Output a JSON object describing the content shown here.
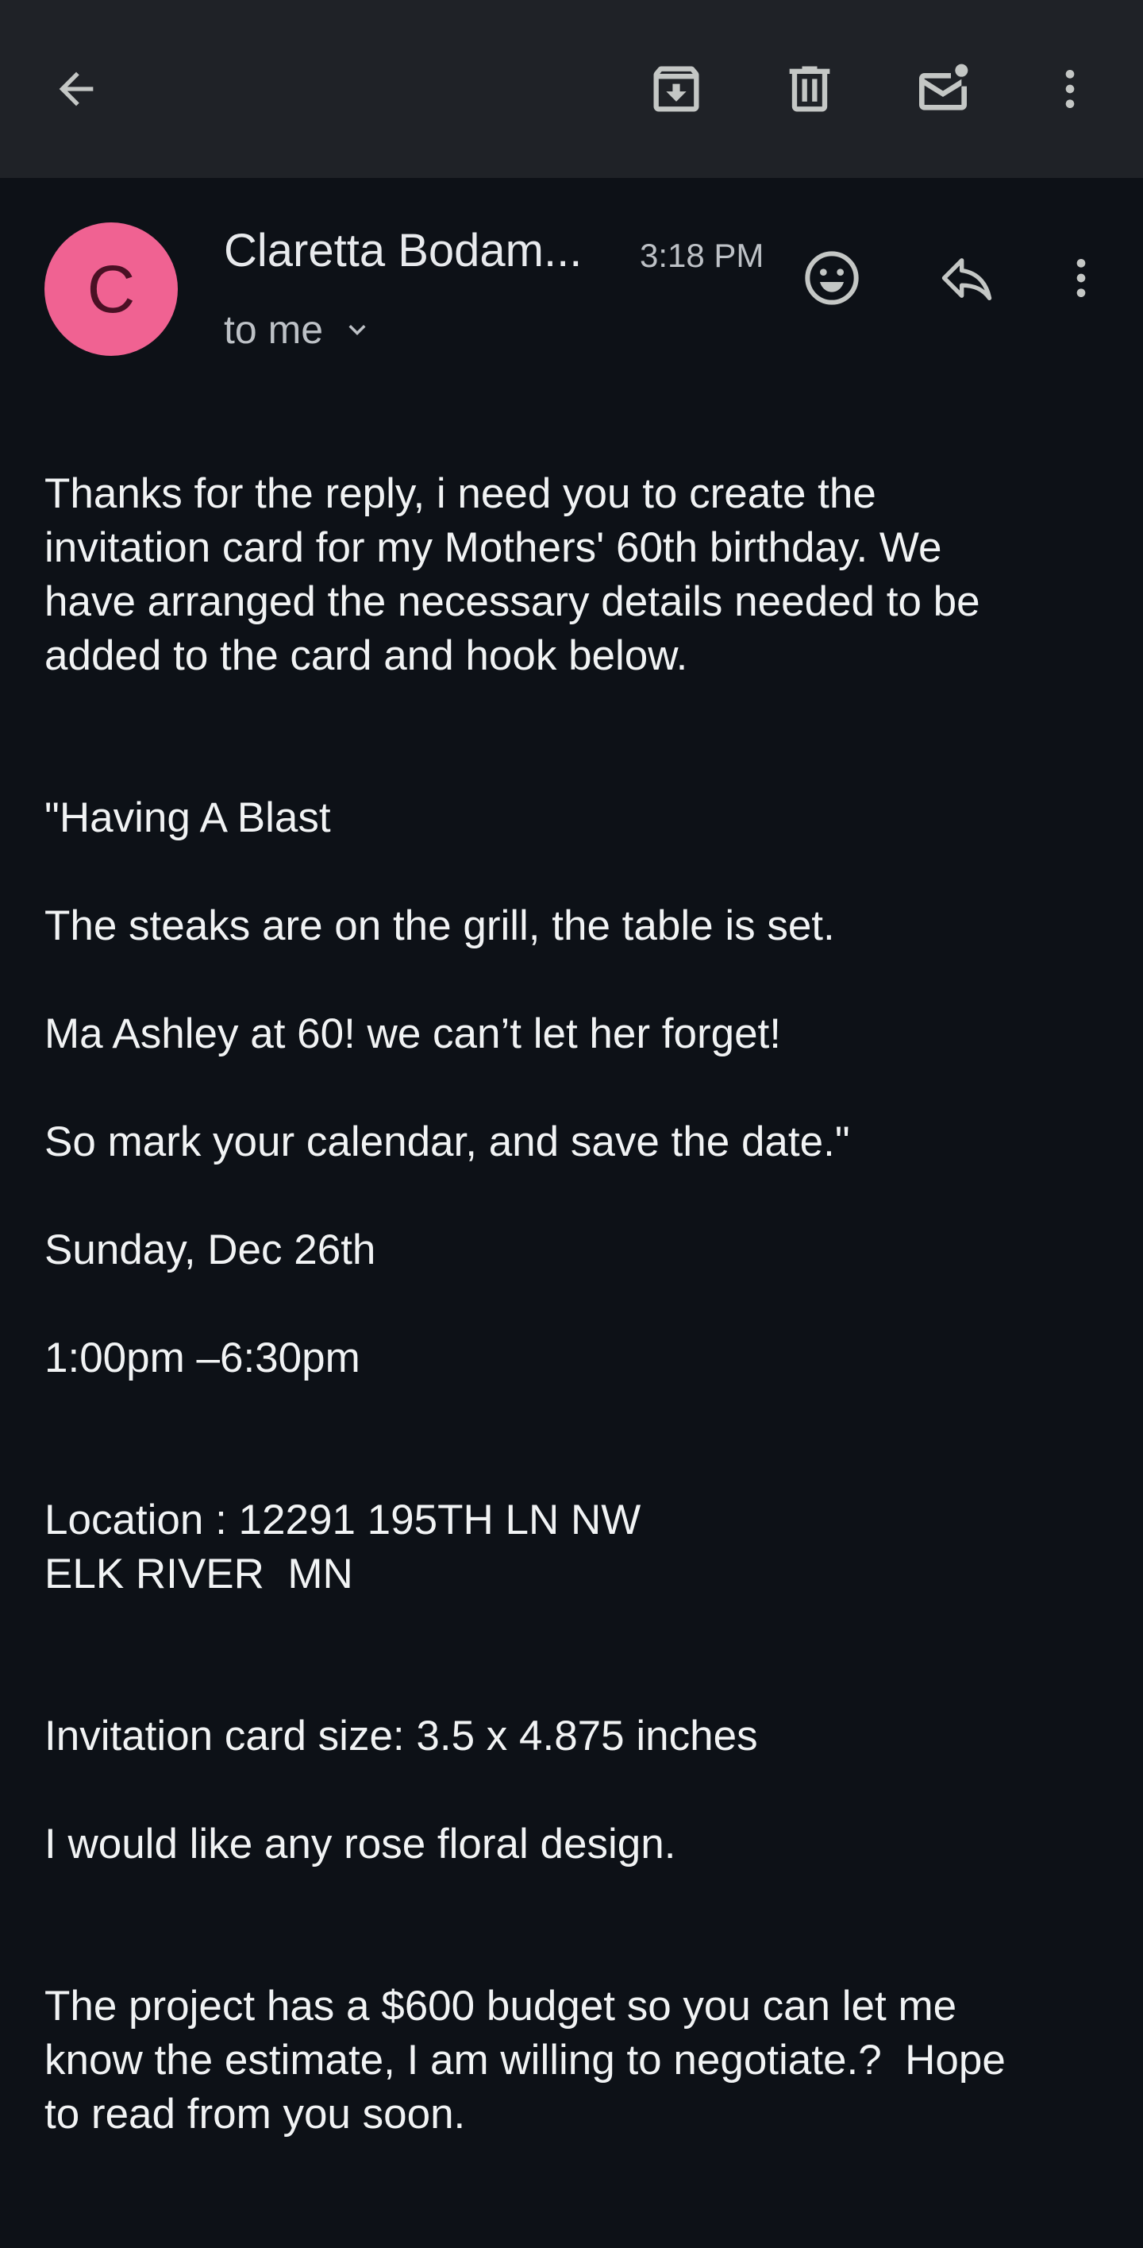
{
  "toolbar": {
    "back_icon": "arrow-left-icon",
    "archive_icon": "archive-icon",
    "delete_icon": "trash-icon",
    "mark_unread_icon": "mail-unread-icon",
    "more_icon": "more-vertical-icon"
  },
  "message": {
    "avatar_letter": "C",
    "avatar_color": "#f06292",
    "sender_name": "Claretta Bodam...",
    "time": "3:18 PM",
    "recipient": "to me",
    "react_icon": "emoji-icon",
    "reply_icon": "reply-icon",
    "more_icon": "more-vertical-icon"
  },
  "body": {
    "intro": "Thanks for the reply, i need you to create the\ninvitation card for my Mothers' 60th birthday. We\nhave arranged the necessary details needed to be\nadded to the card and hook below.",
    "poem_line1": "\"Having A Blast",
    "poem_line2": "The steaks are on the grill, the table is set.",
    "poem_line3": "Ma Ashley at 60! we can’t let her forget!",
    "poem_line4": "So mark your calendar, and save the date.\"",
    "date": "Sunday, Dec 26th",
    "time_range": "1:00pm –6:30pm",
    "location": "Location : 12291 195TH LN NW\nELK RIVER  MN",
    "card_size": "Invitation card size: 3.5 x 4.875 inches",
    "design": "I would like any rose floral design.",
    "budget": "The project has a $600 budget so you can let me\nknow the estimate, I am willing to negotiate.?  Hope\nto read from you soon."
  },
  "colors": {
    "background": "#0d1117",
    "toolbar": "#1f2227",
    "text": "#f1f3f4",
    "secondary_text": "#bdc1c6"
  }
}
